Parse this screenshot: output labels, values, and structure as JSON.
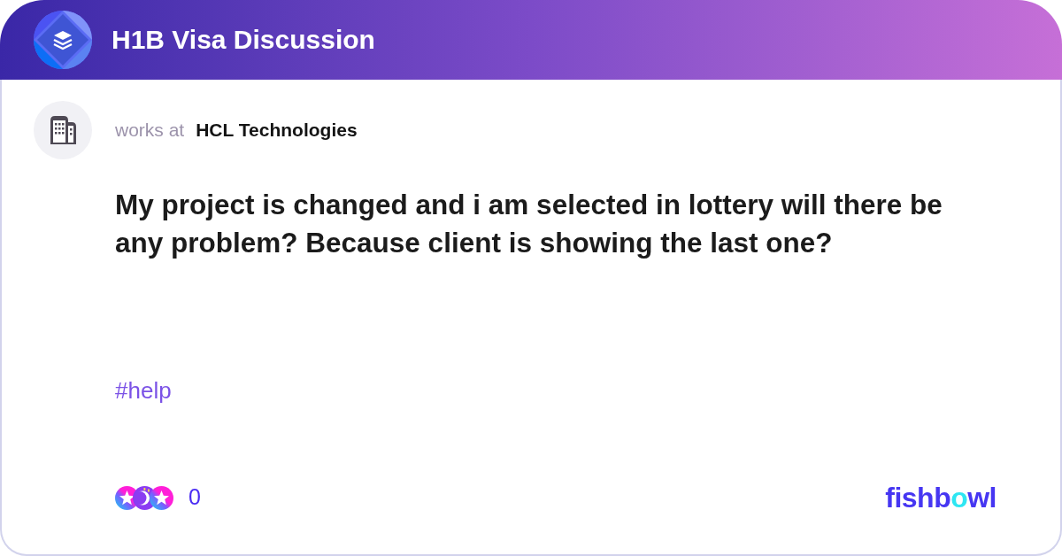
{
  "header": {
    "title": "H1B Visa Discussion"
  },
  "post": {
    "author": {
      "label": "works at",
      "company": "HCL Technologies"
    },
    "body": "My project is changed and i am selected in lottery will there be any problem? Because client is showing the last one?",
    "tags": [
      "#help"
    ]
  },
  "footer": {
    "reactions": {
      "count": "0"
    },
    "logo": {
      "parts": [
        {
          "text": "fishb",
          "color": "#4636f2"
        },
        {
          "text": "o",
          "color": "#2ee6f2"
        },
        {
          "text": "wl",
          "color": "#4636f2"
        }
      ]
    }
  }
}
